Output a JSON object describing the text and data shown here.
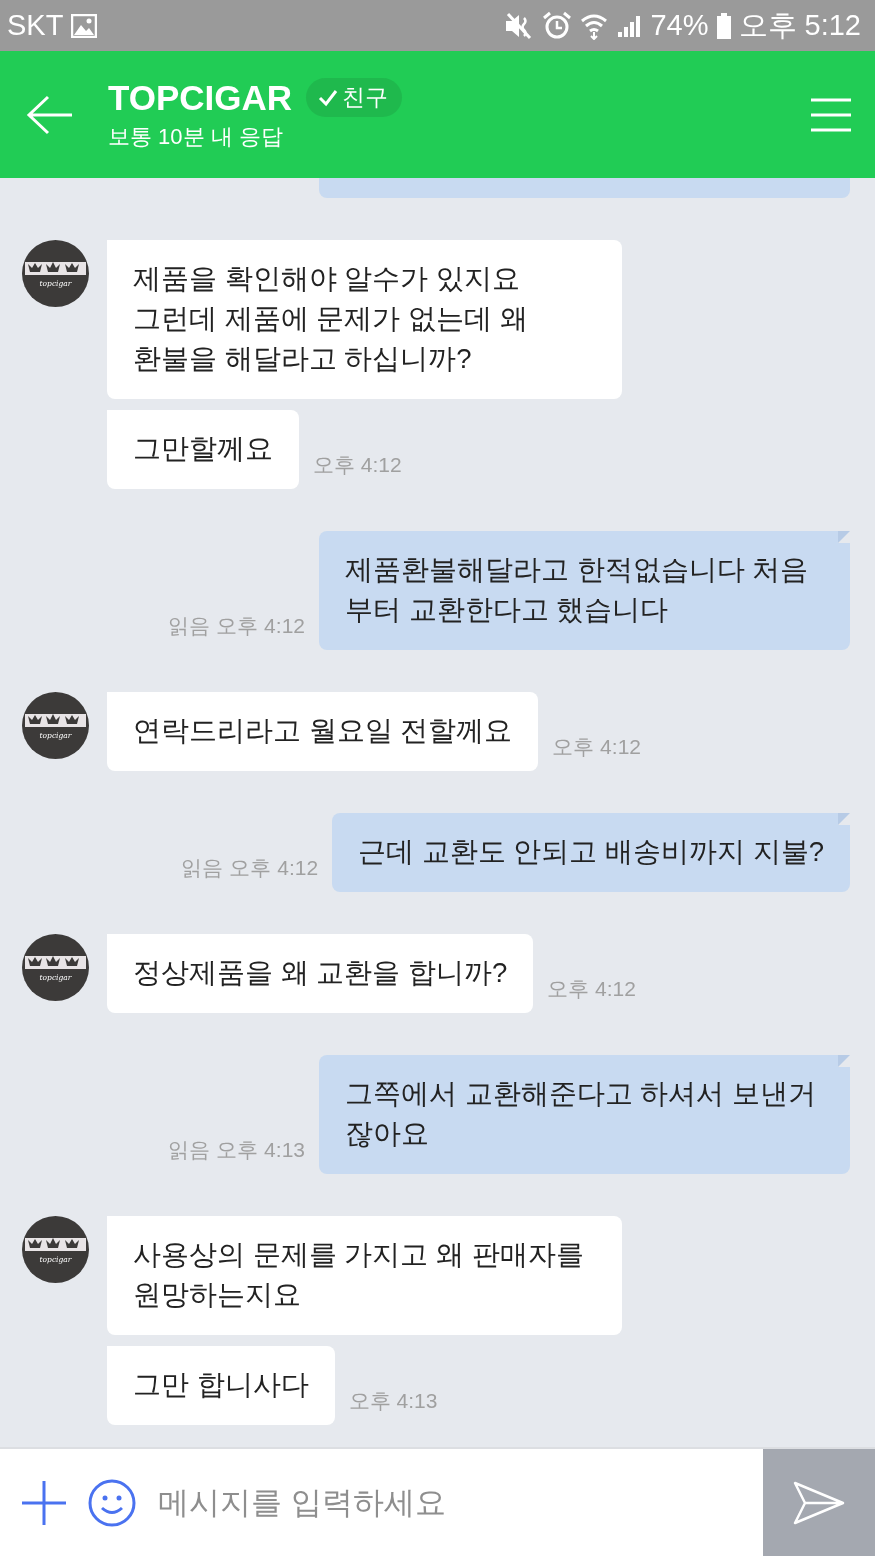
{
  "status_bar": {
    "carrier": "SKT",
    "battery": "74%",
    "time": "오후 5:12"
  },
  "header": {
    "title": "TOPCIGAR",
    "badge": "친구",
    "subtitle": "보통 10분 내 응답"
  },
  "messages": [
    {
      "kind": "fragment"
    },
    {
      "kind": "incoming",
      "avatar": true,
      "avatar_text": "topcigar",
      "text": "제품을 확인해야 알수가 있지요 그런데 제품에 문제가 없는데 왜 환불을 해달라고 하십니까?"
    },
    {
      "kind": "incoming",
      "avatar": false,
      "text": "그만할께요",
      "time": "오후 4:12"
    },
    {
      "kind": "outgoing",
      "read": "읽음",
      "time": "오후 4:12",
      "text": "제품환불해달라고 한적없습니다 처음 부터 교환한다고 했습니다"
    },
    {
      "kind": "incoming",
      "avatar": true,
      "avatar_text": "topcigar",
      "text": "연락드리라고 월요일 전할께요",
      "time": "오후 4:12"
    },
    {
      "kind": "outgoing",
      "read": "읽음",
      "time": "오후 4:12",
      "text": "근데 교환도 안되고 배송비까지 지불?"
    },
    {
      "kind": "incoming",
      "avatar": true,
      "avatar_text": "topcigar",
      "text": "정상제품을 왜 교환을 합니까?",
      "time": "오후 4:12"
    },
    {
      "kind": "outgoing",
      "read": "읽음",
      "time": "오후 4:13",
      "text": "그쪽에서 교환해준다고 하셔서 보낸거 잖아요"
    },
    {
      "kind": "incoming",
      "avatar": true,
      "avatar_text": "topcigar",
      "text": "사용상의 문제를 가지고 왜 판매자를 원망하는지요"
    },
    {
      "kind": "incoming",
      "avatar": false,
      "text": "그만 합니사다",
      "time": "오후 4:13"
    }
  ],
  "input": {
    "placeholder": "메시지를 입력하세요"
  }
}
